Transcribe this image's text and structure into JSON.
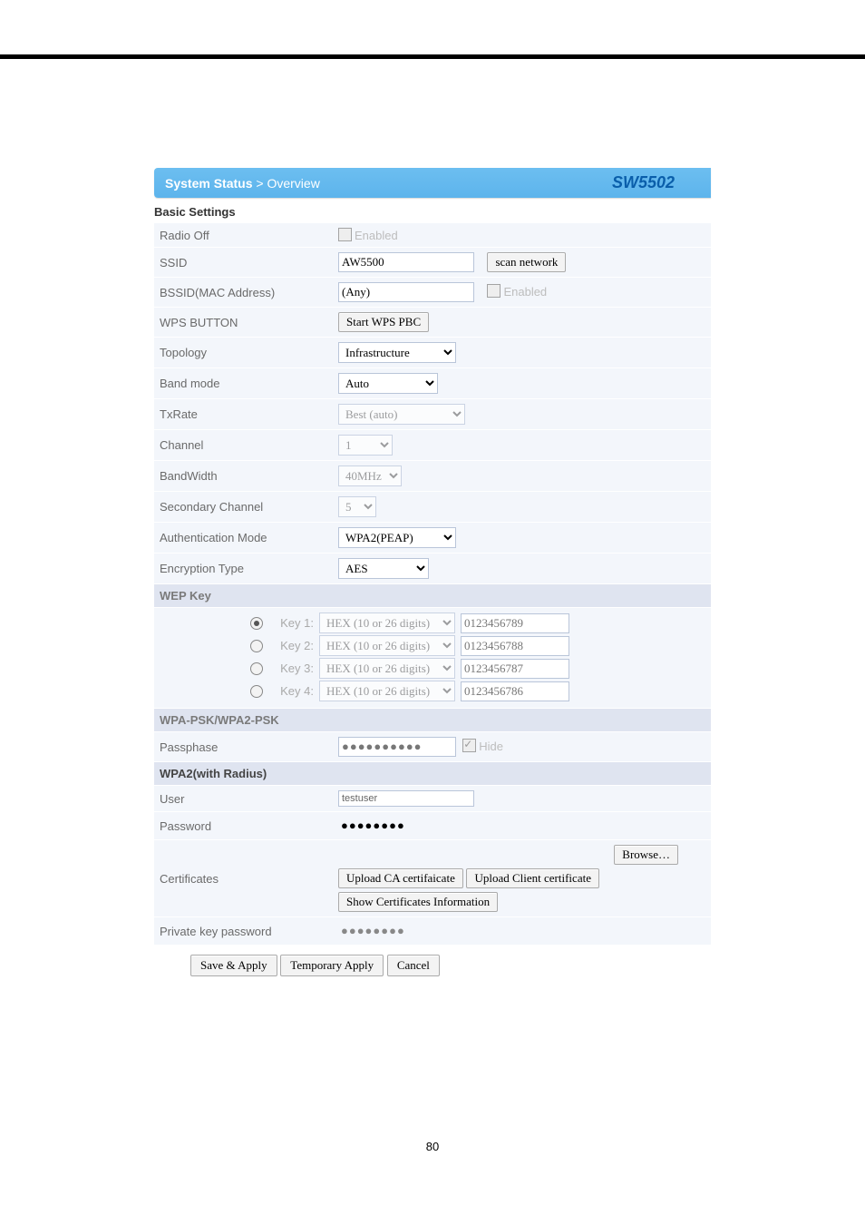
{
  "header": {
    "breadcrumb_prefix": "System  Status",
    "breadcrumb_sep": " > ",
    "breadcrumb_current": "Overview",
    "model": "SW5502"
  },
  "basic": {
    "title": "Basic Settings",
    "radio_off": {
      "label": "Radio Off",
      "enabled_text": "Enabled"
    },
    "ssid": {
      "label": "SSID",
      "value": "AW5500",
      "scan_btn": "scan network"
    },
    "bssid": {
      "label": "BSSID(MAC Address)",
      "value": "(Any)",
      "enabled_text": "Enabled"
    },
    "wps": {
      "label": "WPS BUTTON",
      "btn": "Start WPS PBC"
    },
    "topology": {
      "label": "Topology",
      "value": "Infrastructure"
    },
    "bandmode": {
      "label": "Band mode",
      "value": "Auto"
    },
    "txrate": {
      "label": "TxRate",
      "value": "Best (auto)"
    },
    "channel": {
      "label": "Channel",
      "value": "1"
    },
    "bandwidth": {
      "label": "BandWidth",
      "value": "40MHz"
    },
    "secch": {
      "label": "Secondary Channel",
      "value": "5"
    },
    "authmode": {
      "label": "Authentication Mode",
      "value": "WPA2(PEAP)"
    },
    "enctype": {
      "label": "Encryption Type",
      "value": "AES"
    }
  },
  "wep": {
    "title": "WEP Key",
    "keys": [
      {
        "label": "Key 1:",
        "fmt": "HEX (10 or 26 digits)",
        "val": "0123456789"
      },
      {
        "label": "Key 2:",
        "fmt": "HEX (10 or 26 digits)",
        "val": "0123456788"
      },
      {
        "label": "Key 3:",
        "fmt": "HEX (10 or 26 digits)",
        "val": "0123456787"
      },
      {
        "label": "Key 4:",
        "fmt": "HEX (10 or 26 digits)",
        "val": "0123456786"
      }
    ]
  },
  "psk": {
    "title": "WPA-PSK/WPA2-PSK",
    "passphase_label": "Passphase",
    "passphase_value": "●●●●●●●●●●",
    "hide_text": "Hide"
  },
  "radius": {
    "title": "WPA2(with Radius)",
    "user_label": "User",
    "user_value": "testuser",
    "password_label": "Password",
    "password_value": "●●●●●●●●",
    "cert_label": "Certificates",
    "browse_btn": "Browse…",
    "upload_ca_btn": "Upload CA certifaicate",
    "upload_client_btn": "Upload Client certificate",
    "show_cert_btn": "Show Certificates Information",
    "privkey_label": "Private key password",
    "privkey_value": "●●●●●●●●"
  },
  "buttons": {
    "save": "Save & Apply",
    "temp": "Temporary Apply",
    "cancel": "Cancel"
  },
  "page_number": "80"
}
